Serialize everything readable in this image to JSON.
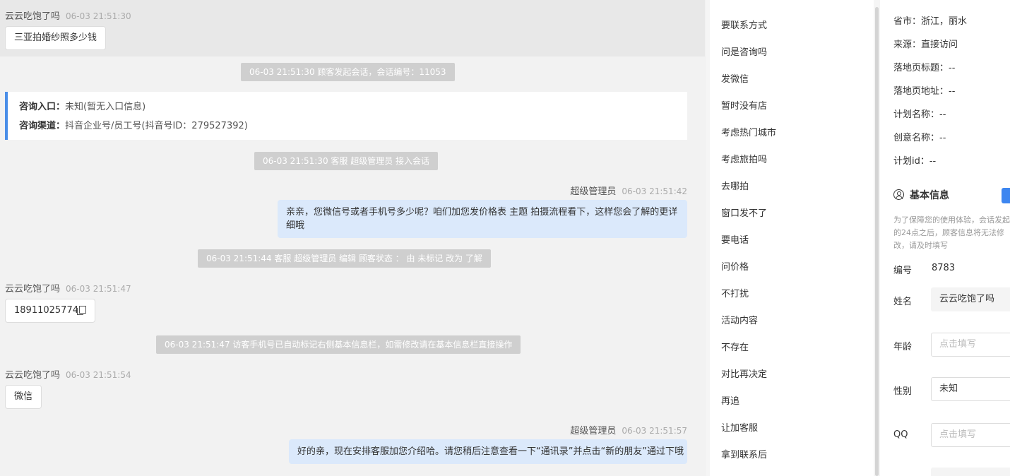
{
  "chat": {
    "customer_name": "云云吃饱了吗",
    "agent_name": "超级管理员",
    "messages": {
      "m1_time": "06-03 21:51:30",
      "m1_text": "三亚拍婚纱照多少钱",
      "sys1": "06-03 21:51:30 顾客发起会话，会话编号：11053",
      "entry_label": "咨询入口：",
      "entry_value": "未知(暂无入口信息)",
      "channel_label": "咨询渠道：",
      "channel_value": "抖音企业号/员工号(抖音号ID：279527392)",
      "sys2": "06-03 21:51:30 客服 超级管理员 接入会话",
      "m2_time": "06-03 21:51:42",
      "m2_text": "亲亲，您微信号或者手机号多少呢？咱们加您发价格表 主题 拍摄流程看下，这样您会了解的更详细哦",
      "sys3": "06-03 21:51:44 客服 超级管理员 编辑 顾客状态 ： 由 未标记 改为 了解",
      "m3_time": "06-03 21:51:47",
      "m3_text": "18911025774",
      "sys4": "06-03 21:51:47 访客手机号已自动标记右侧基本信息栏，如需修改请在基本信息栏直接操作",
      "m4_time": "06-03 21:51:54",
      "m4_text": "微信",
      "m5_time": "06-03 21:51:57",
      "m5_text": "好的亲，现在安排客服加您介绍哈。请您稍后注意查看一下“通讯录”并点击“新的朋友”通过下哦"
    }
  },
  "quick_replies": [
    "要联系方式",
    "问是咨询吗",
    "发微信",
    "暂时没有店",
    "考虑热门城市",
    "考虑旅拍吗",
    "去哪拍",
    "窗口发不了",
    "要电话",
    "问价格",
    "不打扰",
    "活动内容",
    "不存在",
    "对比再决定",
    "再追",
    "让加客服",
    "拿到联系后"
  ],
  "info": {
    "province": "省市：浙江，丽水",
    "source": "来源：直接访问",
    "landing_title": "落地页标题：--",
    "landing_url": "落地页地址：--",
    "plan_name": "计划名称：--",
    "creative_name": "创意名称：--",
    "plan_id": "计划id：--",
    "section_title": "基本信息",
    "notice": "为了保障您的使用体验，会话发起的24点之后，顾客信息将无法修改，请及时填写",
    "id_label": "编号",
    "id_value": "8783",
    "name_label": "姓名",
    "name_value": "云云吃饱了吗",
    "age_label": "年龄",
    "age_placeholder": "点击填写",
    "gender_label": "性别",
    "gender_value": "未知",
    "qq_label": "QQ",
    "qq_placeholder": "点击填写"
  },
  "colors": {
    "accent": "#4a8ee8",
    "agent_bubble": "#dbe9fb",
    "system_pill": "#cfcfcf"
  }
}
